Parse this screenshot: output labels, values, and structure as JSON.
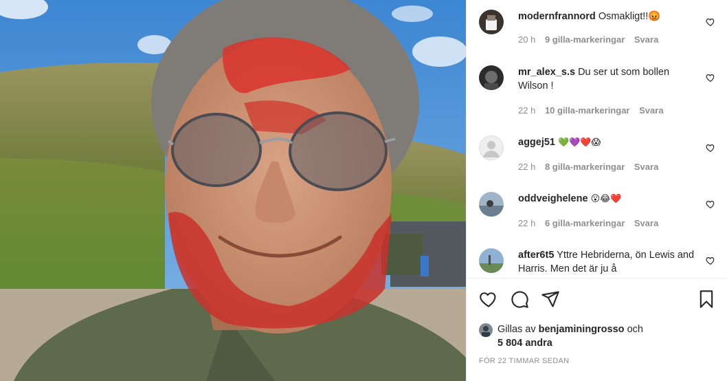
{
  "comments": [
    {
      "username": "modernfrannord",
      "text": "Osmakligt!!😡",
      "time": "20 h",
      "likes": "9 gilla-markeringar",
      "reply": "Svara"
    },
    {
      "username": "mr_alex_s.s",
      "text": "Du ser ut som bollen Wilson !",
      "time": "22 h",
      "likes": "10 gilla-markeringar",
      "reply": "Svara"
    },
    {
      "username": "aggej51",
      "text": "💚💜❤️😱",
      "time": "22 h",
      "likes": "8 gilla-markeringar",
      "reply": "Svara"
    },
    {
      "username": "oddveighelene",
      "text": "😮😂❤️",
      "time": "22 h",
      "likes": "6 gilla-markeringar",
      "reply": "Svara"
    },
    {
      "username": "after6t5",
      "text": "Yttre Hebriderna, ön Lewis and Harris. Men det är ju å",
      "time": "",
      "likes": "",
      "reply": ""
    }
  ],
  "likes_summary": {
    "prefix": "Gillas av",
    "username": "benjaminingrosso",
    "conjunction": "och",
    "others": "5 804 andra"
  },
  "post_time": "FÖR 22 TIMMAR SEDAN",
  "icons": [
    "heart-outline-icon",
    "comment-icon",
    "share-icon",
    "bookmark-icon",
    "small-heart-icon"
  ],
  "colors": {
    "text": "#262626",
    "muted": "#8e8e8e",
    "border": "#efefef"
  }
}
